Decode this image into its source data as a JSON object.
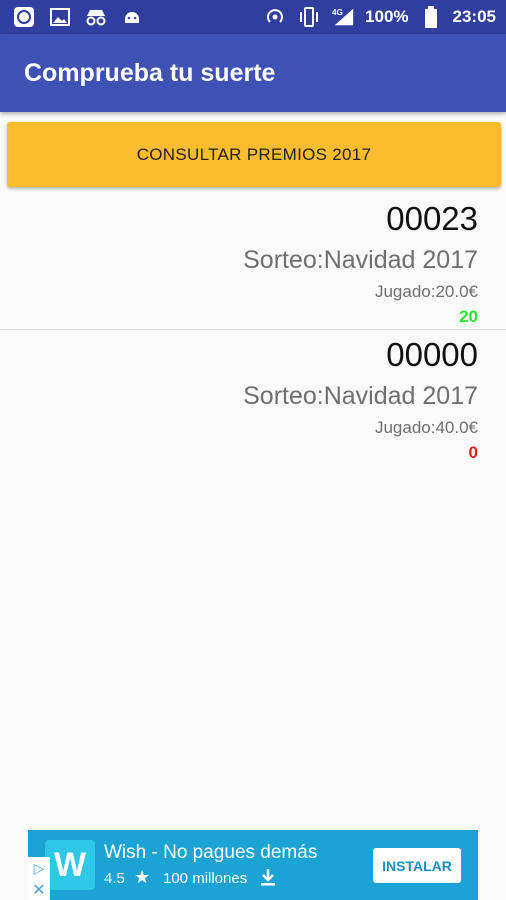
{
  "status_bar": {
    "battery": "100%",
    "time": "23:05",
    "network": "4G",
    "icons_left": [
      "app-icon",
      "image-icon",
      "incognito-icon",
      "android-icon"
    ],
    "icons_right": [
      "hotspot-icon",
      "vibrate-icon",
      "signal-icon",
      "battery-icon"
    ]
  },
  "app_bar": {
    "title": "Comprueba tu suerte"
  },
  "main_button": {
    "label": "CONSULTAR PREMIOS 2017"
  },
  "tickets": [
    {
      "number": "00023",
      "draw": "Sorteo:Navidad 2017",
      "played": "Jugado:20.0€",
      "prize": "20",
      "prize_color": "#2ee82e"
    },
    {
      "number": "00000",
      "draw": "Sorteo:Navidad 2017",
      "played": "Jugado:40.0€",
      "prize": "0",
      "prize_color": "#e02020"
    }
  ],
  "ad": {
    "title": "Wish - No pagues demás",
    "rating": "4.5",
    "installs": "100 millones",
    "button": "INSTALAR",
    "logo_letter": "W",
    "bg_color": "#1aa3d3"
  },
  "colors": {
    "primary": "#3f51b5",
    "primary_dark": "#303f9f",
    "accent": "#fbbc2e"
  }
}
